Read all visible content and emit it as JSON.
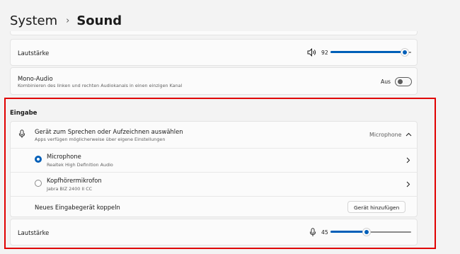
{
  "breadcrumb": {
    "parent": "System",
    "separator": "›",
    "current": "Sound"
  },
  "output": {
    "volume": {
      "label": "Lautstärke",
      "value": "92",
      "level": 0.92,
      "icon": "speaker-icon"
    },
    "mono_audio": {
      "title": "Mono-Audio",
      "subtitle": "Kombinieren des linken und rechten Audiokanals in einen einzigen Kanal",
      "state_label": "Aus",
      "enabled": false
    }
  },
  "input": {
    "section_title": "Eingabe",
    "device_picker": {
      "title": "Gerät zum Sprechen oder Aufzeichnen auswählen",
      "subtitle": "Apps verfügen möglicherweise über eigene Einstellungen",
      "selected": "Microphone",
      "icon": "microphone-icon",
      "expanded": true
    },
    "devices": [
      {
        "name": "Microphone",
        "detail": "Realtek High Definition Audio",
        "selected": true
      },
      {
        "name": "Kopfhörermikrofon",
        "detail": "Jabra BIZ 2400 II CC",
        "selected": false
      }
    ],
    "pair": {
      "label": "Neues Eingabegerät koppeln",
      "button": "Gerät hinzufügen"
    },
    "volume": {
      "label": "Lautstärke",
      "value": "45",
      "level": 0.45,
      "icon": "microphone-icon"
    }
  },
  "colors": {
    "accent": "#005fb8",
    "highlight_border": "#e00000"
  }
}
